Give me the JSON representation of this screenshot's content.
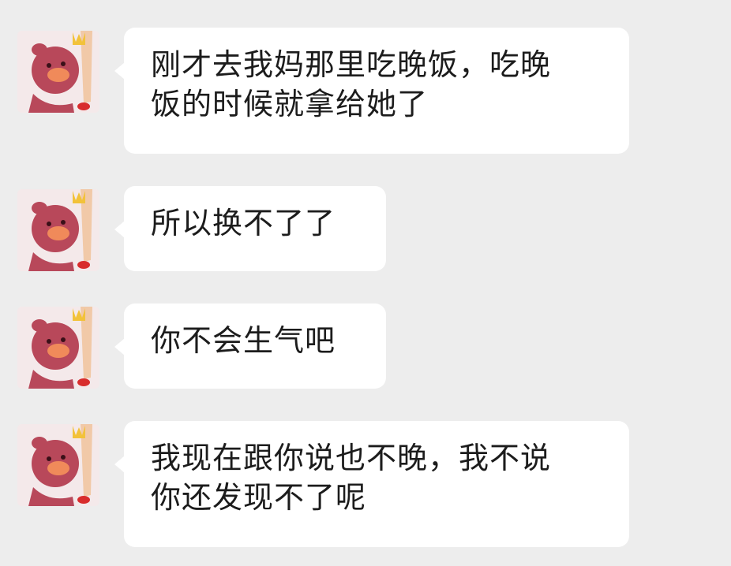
{
  "messages": [
    {
      "avatar": "pig-avatar",
      "lines": [
        "刚才去我妈那里吃晚饭，吃晚",
        "饭的时候就拿给她了"
      ]
    },
    {
      "avatar": "pig-avatar",
      "lines": [
        "所以换不了了"
      ]
    },
    {
      "avatar": "pig-avatar",
      "lines": [
        "你不会生气吧"
      ]
    },
    {
      "avatar": "pig-avatar",
      "lines": [
        "我现在跟你说也不晚，我不说",
        "你还发现不了呢"
      ]
    }
  ],
  "colors": {
    "background": "#ededed",
    "bubble": "#ffffff",
    "avatar_bg": "#f4e9ea",
    "pig": "#b8485a"
  }
}
